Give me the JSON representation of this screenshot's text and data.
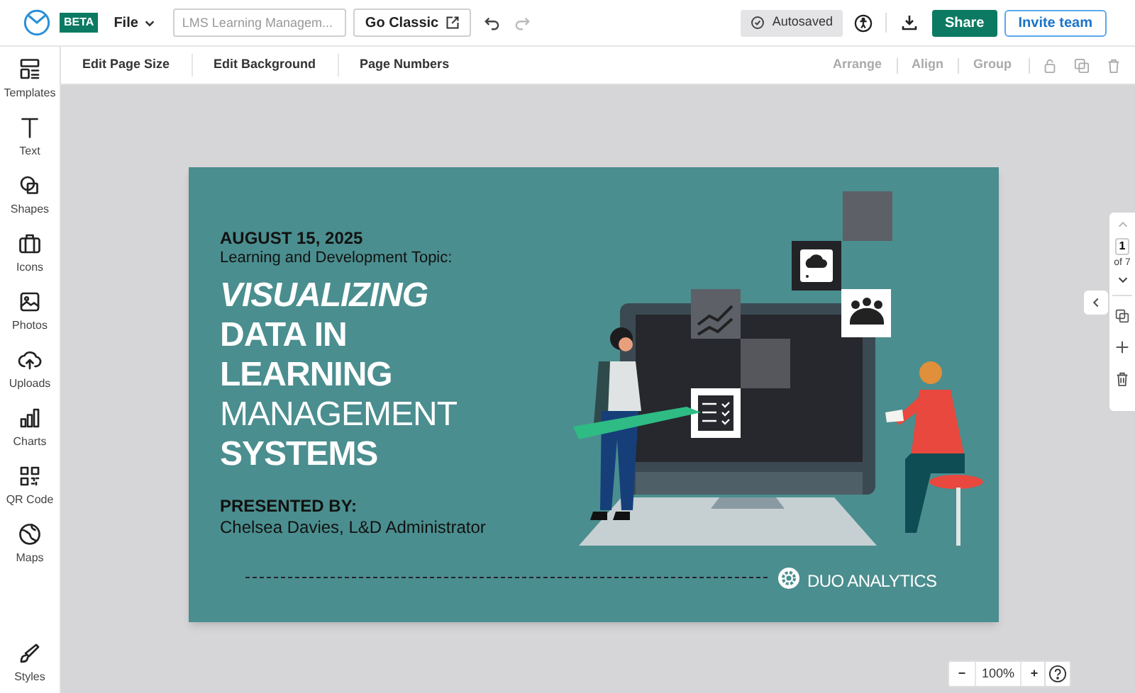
{
  "topbar": {
    "badge": "BETA",
    "file_menu": "File",
    "document_title": {
      "placeholder": "LMS Learning Managem..."
    },
    "go_classic": "Go Classic",
    "autosave": "Autosaved",
    "share": "Share",
    "invite": "Invite team"
  },
  "toolbar": {
    "left": [
      "Edit Page Size",
      "Edit Background",
      "Page Numbers"
    ],
    "right": [
      {
        "label": "Arrange",
        "disabled": true
      },
      {
        "label": "Align",
        "disabled": true
      },
      {
        "label": "Group",
        "disabled": true
      }
    ]
  },
  "sidebar": {
    "items": [
      {
        "label": "Templates",
        "kind": "templates"
      },
      {
        "label": "Text",
        "kind": "text"
      },
      {
        "label": "Shapes",
        "kind": "shapes"
      },
      {
        "label": "Icons",
        "kind": "icons"
      },
      {
        "label": "Photos",
        "kind": "photos"
      },
      {
        "label": "Uploads",
        "kind": "uploads"
      },
      {
        "label": "Charts",
        "kind": "charts"
      },
      {
        "label": "QR Code",
        "kind": "qr"
      },
      {
        "label": "Maps",
        "kind": "maps"
      }
    ],
    "bottom": {
      "label": "Styles",
      "kind": "styles"
    }
  },
  "slide": {
    "date": "AUGUST 15, 2025",
    "topic": "Learning and Development Topic:",
    "title_lines": [
      {
        "text": "VISUALIZING",
        "kind": "bold-italic"
      },
      {
        "text": "DATA IN",
        "kind": "bold"
      },
      {
        "text": "LEARNING",
        "kind": "bold"
      },
      {
        "text": "MANAGEMENT",
        "kind": "light"
      },
      {
        "text": "SYSTEMS",
        "kind": "bold"
      }
    ],
    "presented_by": "PRESENTED BY:",
    "presenter": "Chelsea Davies, L&D Administrator",
    "logo_text": "DUO ANALYTICS"
  },
  "page_nav": {
    "current": "1",
    "total": "of 7"
  },
  "zoom": {
    "value": "100%",
    "minus": "−",
    "plus": "+"
  }
}
